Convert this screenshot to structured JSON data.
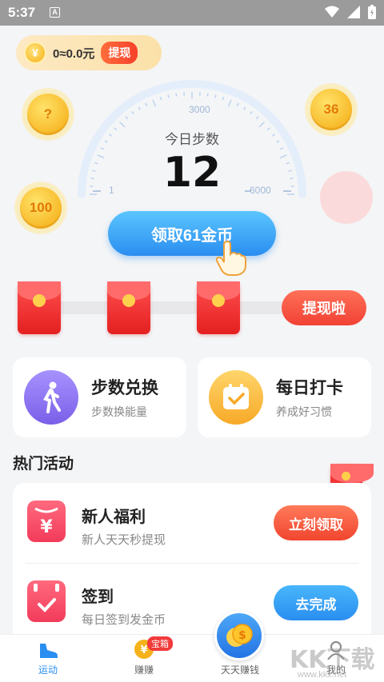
{
  "status_bar": {
    "time": "5:37",
    "badge": "A"
  },
  "wallet": {
    "amount": "0≈0.0元",
    "withdraw": "提现",
    "coin_symbol": "¥"
  },
  "floating_coins": [
    {
      "label": "?"
    },
    {
      "label": "36"
    },
    {
      "label": "100"
    }
  ],
  "gauge": {
    "title": "今日步数",
    "steps": "12",
    "min_label": "1",
    "mid_label": "3000",
    "max_label": "6000",
    "level": 0.002
  },
  "claim_button": "领取61金币",
  "envelope_row": {
    "withdraw_button": "提现啦"
  },
  "features": [
    {
      "title": "步数兑换",
      "subtitle": "步数换能量",
      "color": "#8b74f0"
    },
    {
      "title": "每日打卡",
      "subtitle": "养成好习惯",
      "color": "#f7b535"
    }
  ],
  "section_title": "热门活动",
  "activities": [
    {
      "title": "新人福利",
      "subtitle": "新人天天秒提现",
      "button": "立刻领取",
      "button_color": "#f4563c"
    },
    {
      "title": "签到",
      "subtitle": "每日签到发金币",
      "button": "去完成",
      "button_color": "#2a9cf0"
    }
  ],
  "nav": {
    "items": [
      {
        "label": "运动"
      },
      {
        "label": "赚赚",
        "badge": "宝箱"
      },
      {
        "label": "天天赚钱"
      },
      {
        "label": "我的"
      }
    ],
    "accent": "#2a8ef0"
  },
  "watermark": {
    "text": "KK下载",
    "url": "www.kkx.net"
  }
}
